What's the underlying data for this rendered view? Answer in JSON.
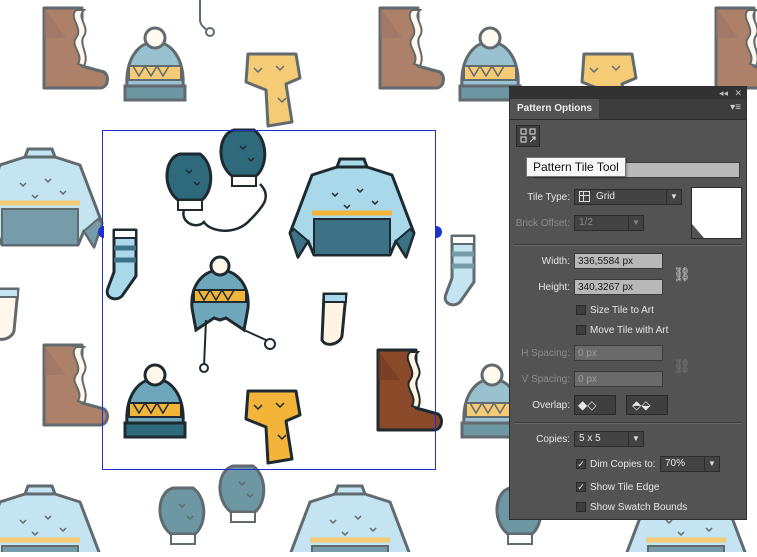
{
  "panel": {
    "title": "Pattern Options",
    "collapse_glyph": "◂◂",
    "close_glyph": "✕",
    "menu_glyph": "▾≡",
    "tool_icon": "pattern-tile-tool-icon",
    "tooltip": "Pattern Tile Tool",
    "name_value": "",
    "tile_type_label": "Tile Type:",
    "tile_type_value": "Grid",
    "brick_offset_label": "Brick Offset:",
    "brick_offset_value": "1/2",
    "width_label": "Width:",
    "width_value": "336,5584 px",
    "height_label": "Height:",
    "height_value": "340,3267 px",
    "size_tile_label": "Size Tile to Art",
    "size_tile_checked": false,
    "move_tile_label": "Move Tile with Art",
    "move_tile_checked": false,
    "h_spacing_label": "H Spacing:",
    "h_spacing_value": "0 px",
    "v_spacing_label": "V Spacing:",
    "v_spacing_value": "0 px",
    "overlap_label": "Overlap:",
    "copies_label": "Copies:",
    "copies_value": "5 x 5",
    "dim_copies_label": "Dim Copies to:",
    "dim_copies_checked": true,
    "dim_copies_value": "70%",
    "show_tile_edge_label": "Show Tile Edge",
    "show_tile_edge_checked": true,
    "show_swatch_bounds_label": "Show Swatch Bounds",
    "show_swatch_bounds_checked": false
  },
  "colors": {
    "panel_bg": "#535353",
    "tile_edge": "#1f2fd0",
    "sweater_light": "#a9d8ea",
    "sweater_dark": "#3d7185",
    "boot_brown": "#8a4a2a",
    "mustard": "#f2b53a",
    "teal": "#2f6a7c"
  }
}
